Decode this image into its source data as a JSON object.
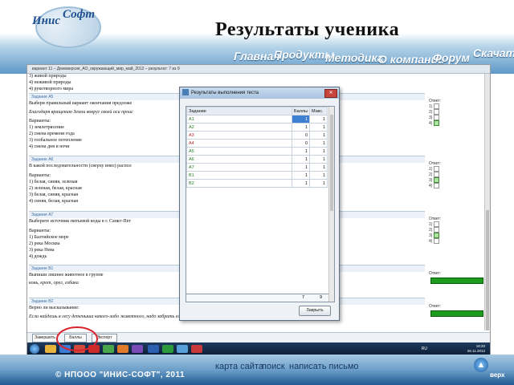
{
  "header": {
    "logo_line1": "Инис",
    "logo_line2": "Софт",
    "title": "Результаты ученика",
    "nav": [
      "Главная",
      "Продукты",
      "Методика",
      "О компании",
      "Форум",
      "Скачать"
    ]
  },
  "screen": {
    "window_title": "вариант 11 – Демоверсия_АО_окружающий_мир_май_2012 – результат: 7 из 9",
    "questions": [
      {
        "lines": [
          "3) живой природы",
          "4) неживой природы",
          "4) рукотворного мира"
        ]
      },
      {
        "header": "Задание А5",
        "lines": [
          "Выбери правильный вариант окончания предложе",
          "Благодаря вращению Земли вокруг своей оси проис",
          "Варианты:",
          "1) землетрясение",
          "2) смена времени года",
          "3) глобальное потепление",
          "4) смена дня и ночи"
        ],
        "answer_label": "Ответ:",
        "options": [
          "1)",
          "2)",
          "3)",
          "4)"
        ],
        "checked": 3
      },
      {
        "header": "Задание А6",
        "lines": [
          "В какой последовательности (сверху вниз) распол",
          "Варианты:",
          "1) белая, синяя, зеленая",
          "2) зеленая, белая, красная",
          "3) белая, синяя, красная",
          "4) синяя, белая, красная"
        ],
        "answer_label": "Ответ:",
        "options": [
          "1)",
          "2)",
          "3)",
          "4)"
        ],
        "checked": 2
      },
      {
        "header": "Задание А7",
        "lines": [
          "Выберите источник питьевой воды в г. Санкт-Пет",
          "Варианты:",
          "1) Балтийское море",
          "2) река Москва",
          "3) река Нева",
          "4) дождь"
        ],
        "answer_label": "Ответ:",
        "options": [
          "1)",
          "2)",
          "3)",
          "4)"
        ],
        "checked": 2
      },
      {
        "header": "Задание В1",
        "lines": [
          "Выпиши лишнее животное в группе",
          "конь, крот, орел, собака"
        ],
        "answer_label": "Ответ:"
      },
      {
        "header": "Задание В2",
        "lines": [
          "Верно ли высказывание:",
          "Если найдешь в лесу детеныша какого-либо животного, надо забрать его с собой в город, чтобы он не погиб."
        ],
        "answer_label": "Ответ:"
      }
    ],
    "bottom_buttons": [
      "Завершить",
      "Баллы",
      "Экспорт"
    ],
    "taskbar": {
      "lang": "RU",
      "time": "18:20",
      "date": "28.11.2012"
    }
  },
  "dialog": {
    "title": "Результаты выполнения теста",
    "columns": [
      "Задание",
      "Баллы",
      "Макс."
    ],
    "rows": [
      {
        "task": "А1",
        "score": "1",
        "max": "1"
      },
      {
        "task": "А2",
        "score": "1",
        "max": "1"
      },
      {
        "task": "А3",
        "score": "0",
        "max": "1"
      },
      {
        "task": "А4",
        "score": "0",
        "max": "1"
      },
      {
        "task": "А5",
        "score": "1",
        "max": "1"
      },
      {
        "task": "А6",
        "score": "1",
        "max": "1"
      },
      {
        "task": "А7",
        "score": "1",
        "max": "1"
      },
      {
        "task": "В1",
        "score": "1",
        "max": "1"
      },
      {
        "task": "В2",
        "score": "1",
        "max": "1"
      }
    ],
    "total_score": "7",
    "total_max": "9",
    "close_label": "Закрыть"
  },
  "footer": {
    "copyright": "© НПООО \"ИНИС-СОФТ\", 2011",
    "links": [
      "карта сайта",
      "поиск",
      "написать письмо"
    ],
    "up_label": "верх"
  },
  "colors": {
    "accent": "#1f5a91",
    "wrong": "#b0282f",
    "correct": "#2a7a2a",
    "highlight": "#d9232d"
  }
}
